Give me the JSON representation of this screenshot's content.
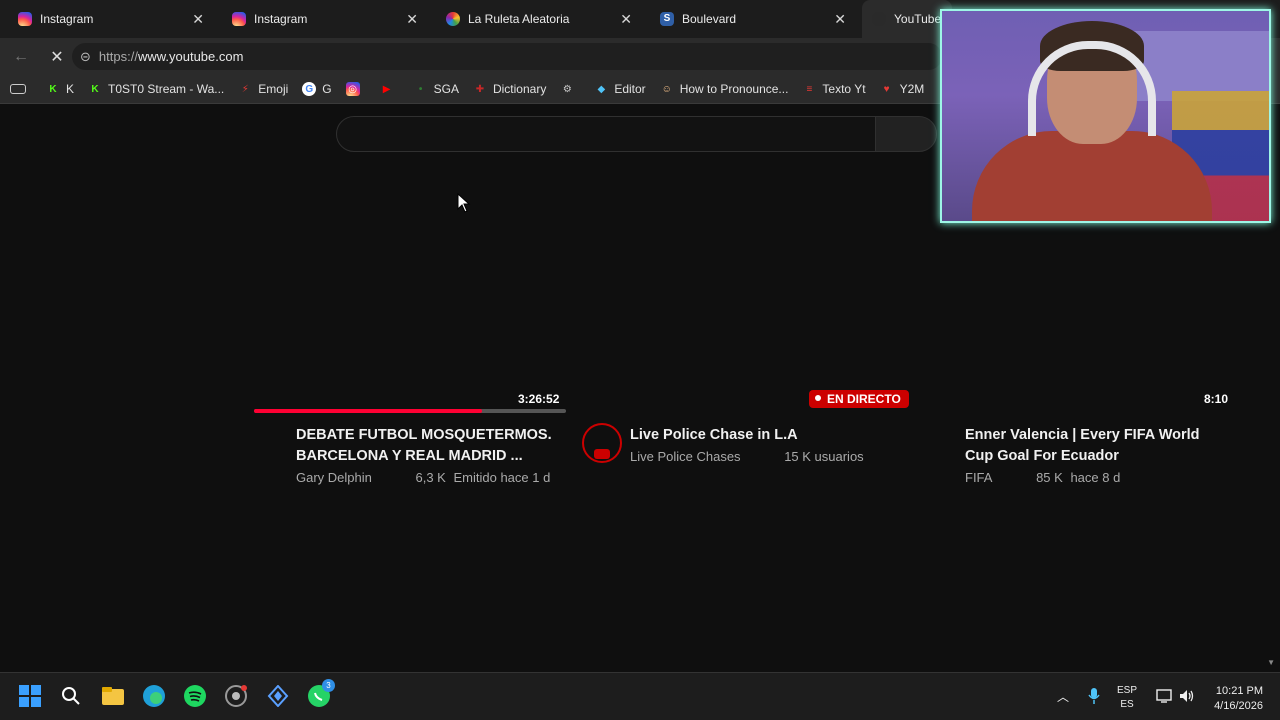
{
  "browser": {
    "tabs": [
      {
        "label": "Instagram",
        "icon": "instagram-icon"
      },
      {
        "label": "Instagram",
        "icon": "instagram-icon"
      },
      {
        "label": "La Ruleta Aleatoria",
        "icon": "ruleta-icon"
      },
      {
        "label": "Boulevard",
        "icon": "s-icon"
      },
      {
        "label": "YouTube",
        "icon": "youtube-loading-icon"
      }
    ],
    "close_glyph": "✕",
    "url_scheme": "https://",
    "url_host": "www.youtube.com"
  },
  "bookmarks": [
    {
      "label": "K",
      "color": "#53fc18",
      "glyph": "K"
    },
    {
      "label": "T0ST0 Stream - Wa...",
      "color": "#53fc18",
      "glyph": "K"
    },
    {
      "label": "Emoji",
      "color": "#e53935",
      "glyph": "⚡"
    },
    {
      "label": "G",
      "color": "#ffffff",
      "glyph": "G"
    },
    {
      "label": "",
      "color": "#d6249f",
      "glyph": "◎"
    },
    {
      "label": "",
      "color": "#ff0000",
      "glyph": "▶"
    },
    {
      "label": "SGA",
      "color": "#2e7d32",
      "glyph": "•"
    },
    {
      "label": "Dictionary",
      "color": "#c62828",
      "glyph": "✚"
    },
    {
      "label": "",
      "color": "#cccccc",
      "glyph": "⚙"
    },
    {
      "label": "Editor",
      "color": "#4fc3f7",
      "glyph": "◆"
    },
    {
      "label": "How to Pronounce...",
      "color": "#f5c08a",
      "glyph": "☺"
    },
    {
      "label": "Texto Yt",
      "color": "#e53935",
      "glyph": "≡"
    },
    {
      "label": "Y2M",
      "color": "#e53935",
      "glyph": "♥"
    }
  ],
  "videos": [
    {
      "duration": "3:26:52",
      "title_line1": "DEBATE FUTBOL MOSQUETERMOS.",
      "title_line2": "BARCELONA Y REAL MADRID ...",
      "channel": "Gary Delphin",
      "views": "6,3 K",
      "age": "Emitido hace 1 d",
      "watched_fraction": 0.73
    },
    {
      "live_badge": "EN DIRECTO",
      "title_line1": "Live Police Chase in L.A",
      "channel": "Live Police Chases",
      "viewers": "15 K usuarios"
    },
    {
      "duration": "8:10",
      "title_line1": "Enner Valencia | Every FIFA World",
      "title_line2": "Cup Goal For Ecuador",
      "channel": "FIFA",
      "views": "85 K",
      "age": "hace 8 d"
    }
  ],
  "taskbar": {
    "whatsapp_badge": "3",
    "lang_line1": "ESP",
    "lang_line2": "ES",
    "time": "10:21 PM",
    "date": "4/16/2026"
  },
  "colors": {
    "youtube_red": "#ff0033",
    "live_red": "#cc0000",
    "webcam_border": "#9ef6e6"
  }
}
